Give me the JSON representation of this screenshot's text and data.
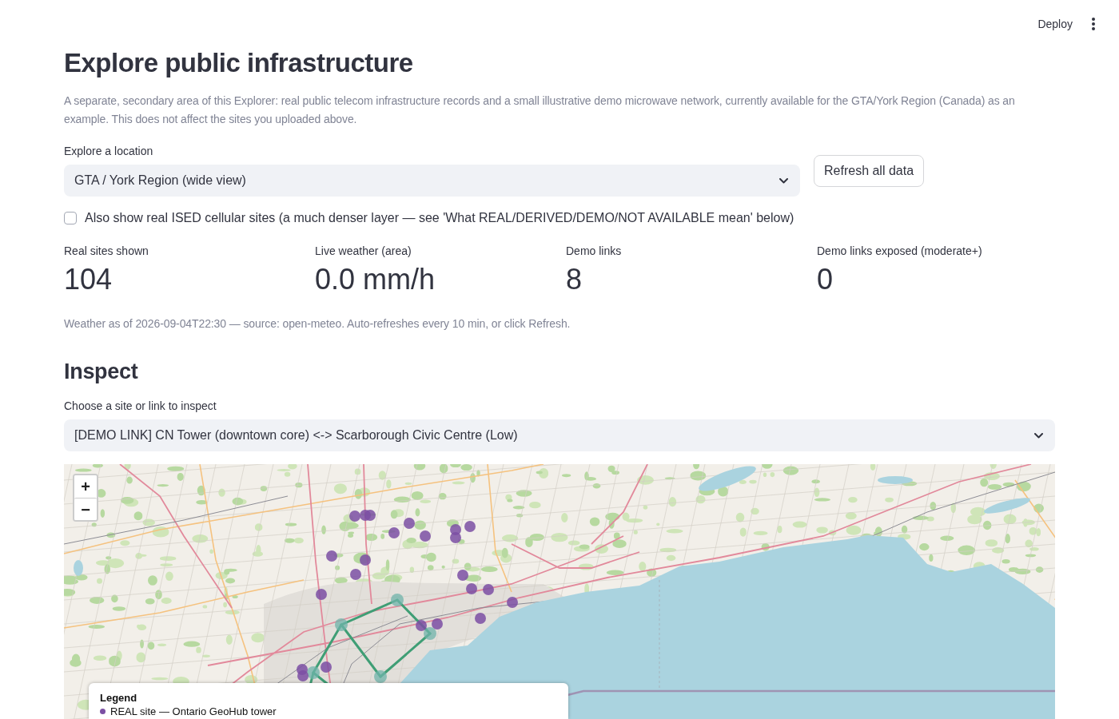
{
  "toolbar": {
    "deploy": "Deploy"
  },
  "title": "Explore public infrastructure",
  "description": "A separate, secondary area of this Explorer: real public telecom infrastructure records and a small illustrative demo microwave network, currently available for the GTA/York Region (Canada) as an example. This does not affect the sites you uploaded above.",
  "location": {
    "label": "Explore a location",
    "value": "GTA / York Region (wide view)"
  },
  "refresh_button": "Refresh all data",
  "cellular_checkbox": {
    "label": "Also show real ISED cellular sites (a much denser layer — see 'What REAL/DERIVED/DEMO/NOT AVAILABLE mean' below)",
    "checked": false
  },
  "metrics": [
    {
      "label": "Real sites shown",
      "value": "104"
    },
    {
      "label": "Live weather (area)",
      "value": "0.0 mm/h"
    },
    {
      "label": "Demo links",
      "value": "8"
    },
    {
      "label": "Demo links exposed (moderate+)",
      "value": "0"
    }
  ],
  "weather_caption": "Weather as of 2026-09-04T22:30 — source: open-meteo. Auto-refreshes every 10 min, or click Refresh.",
  "inspect": {
    "heading": "Inspect",
    "label": "Choose a site or link to inspect",
    "value": "[DEMO LINK] CN Tower (downtown core) <-> Scarborough Civic Centre (Low)"
  },
  "map": {
    "zoom_in": "+",
    "zoom_out": "−",
    "legend": {
      "title": "Legend",
      "items": [
        {
          "label": "REAL site — Ontario GeoHub tower",
          "color": "#7b4fa3"
        }
      ]
    }
  }
}
